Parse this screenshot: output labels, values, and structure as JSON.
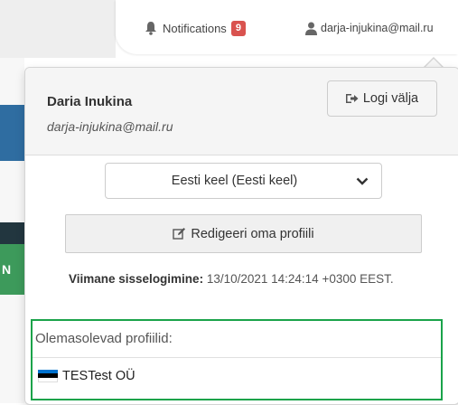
{
  "header": {
    "notifications_label": "Notifications",
    "notifications_count": "9",
    "user_email": "darja-injukina@mail.ru"
  },
  "left_page": {
    "partial_button_text": "N"
  },
  "user_menu": {
    "name": "Daria Inukina",
    "email": "darja-injukina@mail.ru",
    "logout_label": "Logi välja",
    "language_selected": "Eesti keel (Eesti keel)",
    "edit_profile_label": "Redigeeri oma profiili",
    "last_login_label": "Viimane sisselogimine:",
    "last_login_value": "13/10/2021 14:24:14 +0300 EEST.",
    "profiles_title": "Olemasolevad profiilid:",
    "profiles": [
      {
        "name": "TESTest OÜ",
        "flag_colors": [
          "#0072ce",
          "#000000",
          "#ffffff"
        ]
      }
    ]
  },
  "colors": {
    "badge": "#d9534f",
    "highlight_border": "#1aa34a",
    "left_blue": "#2f6da1",
    "left_green": "#3d9a5b"
  },
  "icons": {
    "notifications": "bell-icon",
    "user": "user-icon",
    "logout": "logout-icon",
    "dropdown": "chevron-down-icon",
    "edit": "edit-icon",
    "profile_flag": "estonia-flag-icon"
  }
}
